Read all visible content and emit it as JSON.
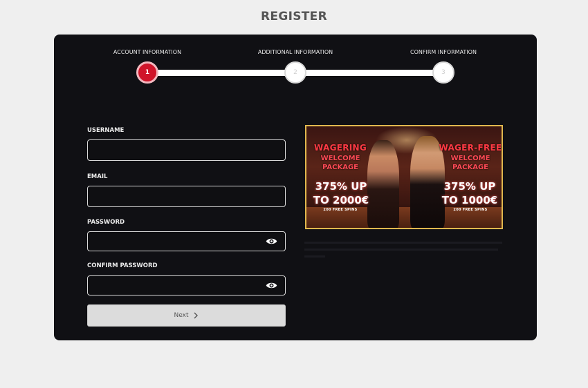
{
  "header": {
    "title": "REGISTER"
  },
  "stepper": {
    "steps": [
      {
        "label": "ACCOUNT INFORMATION",
        "number": "1",
        "active": true
      },
      {
        "label": "ADDITIONAL INFORMATION",
        "number": "2",
        "active": false
      },
      {
        "label": "CONFIRM INFORMATION",
        "number": "3",
        "active": false
      }
    ]
  },
  "form": {
    "username": {
      "label": "USERNAME",
      "value": ""
    },
    "email": {
      "label": "EMAIL",
      "value": ""
    },
    "password": {
      "label": "PASSWORD",
      "value": ""
    },
    "confirm_password": {
      "label": "CONFIRM PASSWORD",
      "value": ""
    },
    "next_label": "Next"
  },
  "banner": {
    "left": {
      "title": "WAGERING",
      "line1": "WELCOME",
      "line2": "PACKAGE",
      "bonus1": "375% UP",
      "bonus2": "TO 2000€",
      "spins": "200 FREE SPINS"
    },
    "right": {
      "title": "WAGER-FREE",
      "line1": "WELCOME",
      "line2": "PACKAGE",
      "bonus1": "375% UP",
      "bonus2": "TO 1000€",
      "spins": "200 FREE SPINS"
    },
    "accent": "#e0b84e"
  },
  "colors": {
    "accent": "#d0142a",
    "panel": "#101014",
    "background": "#efefef"
  }
}
